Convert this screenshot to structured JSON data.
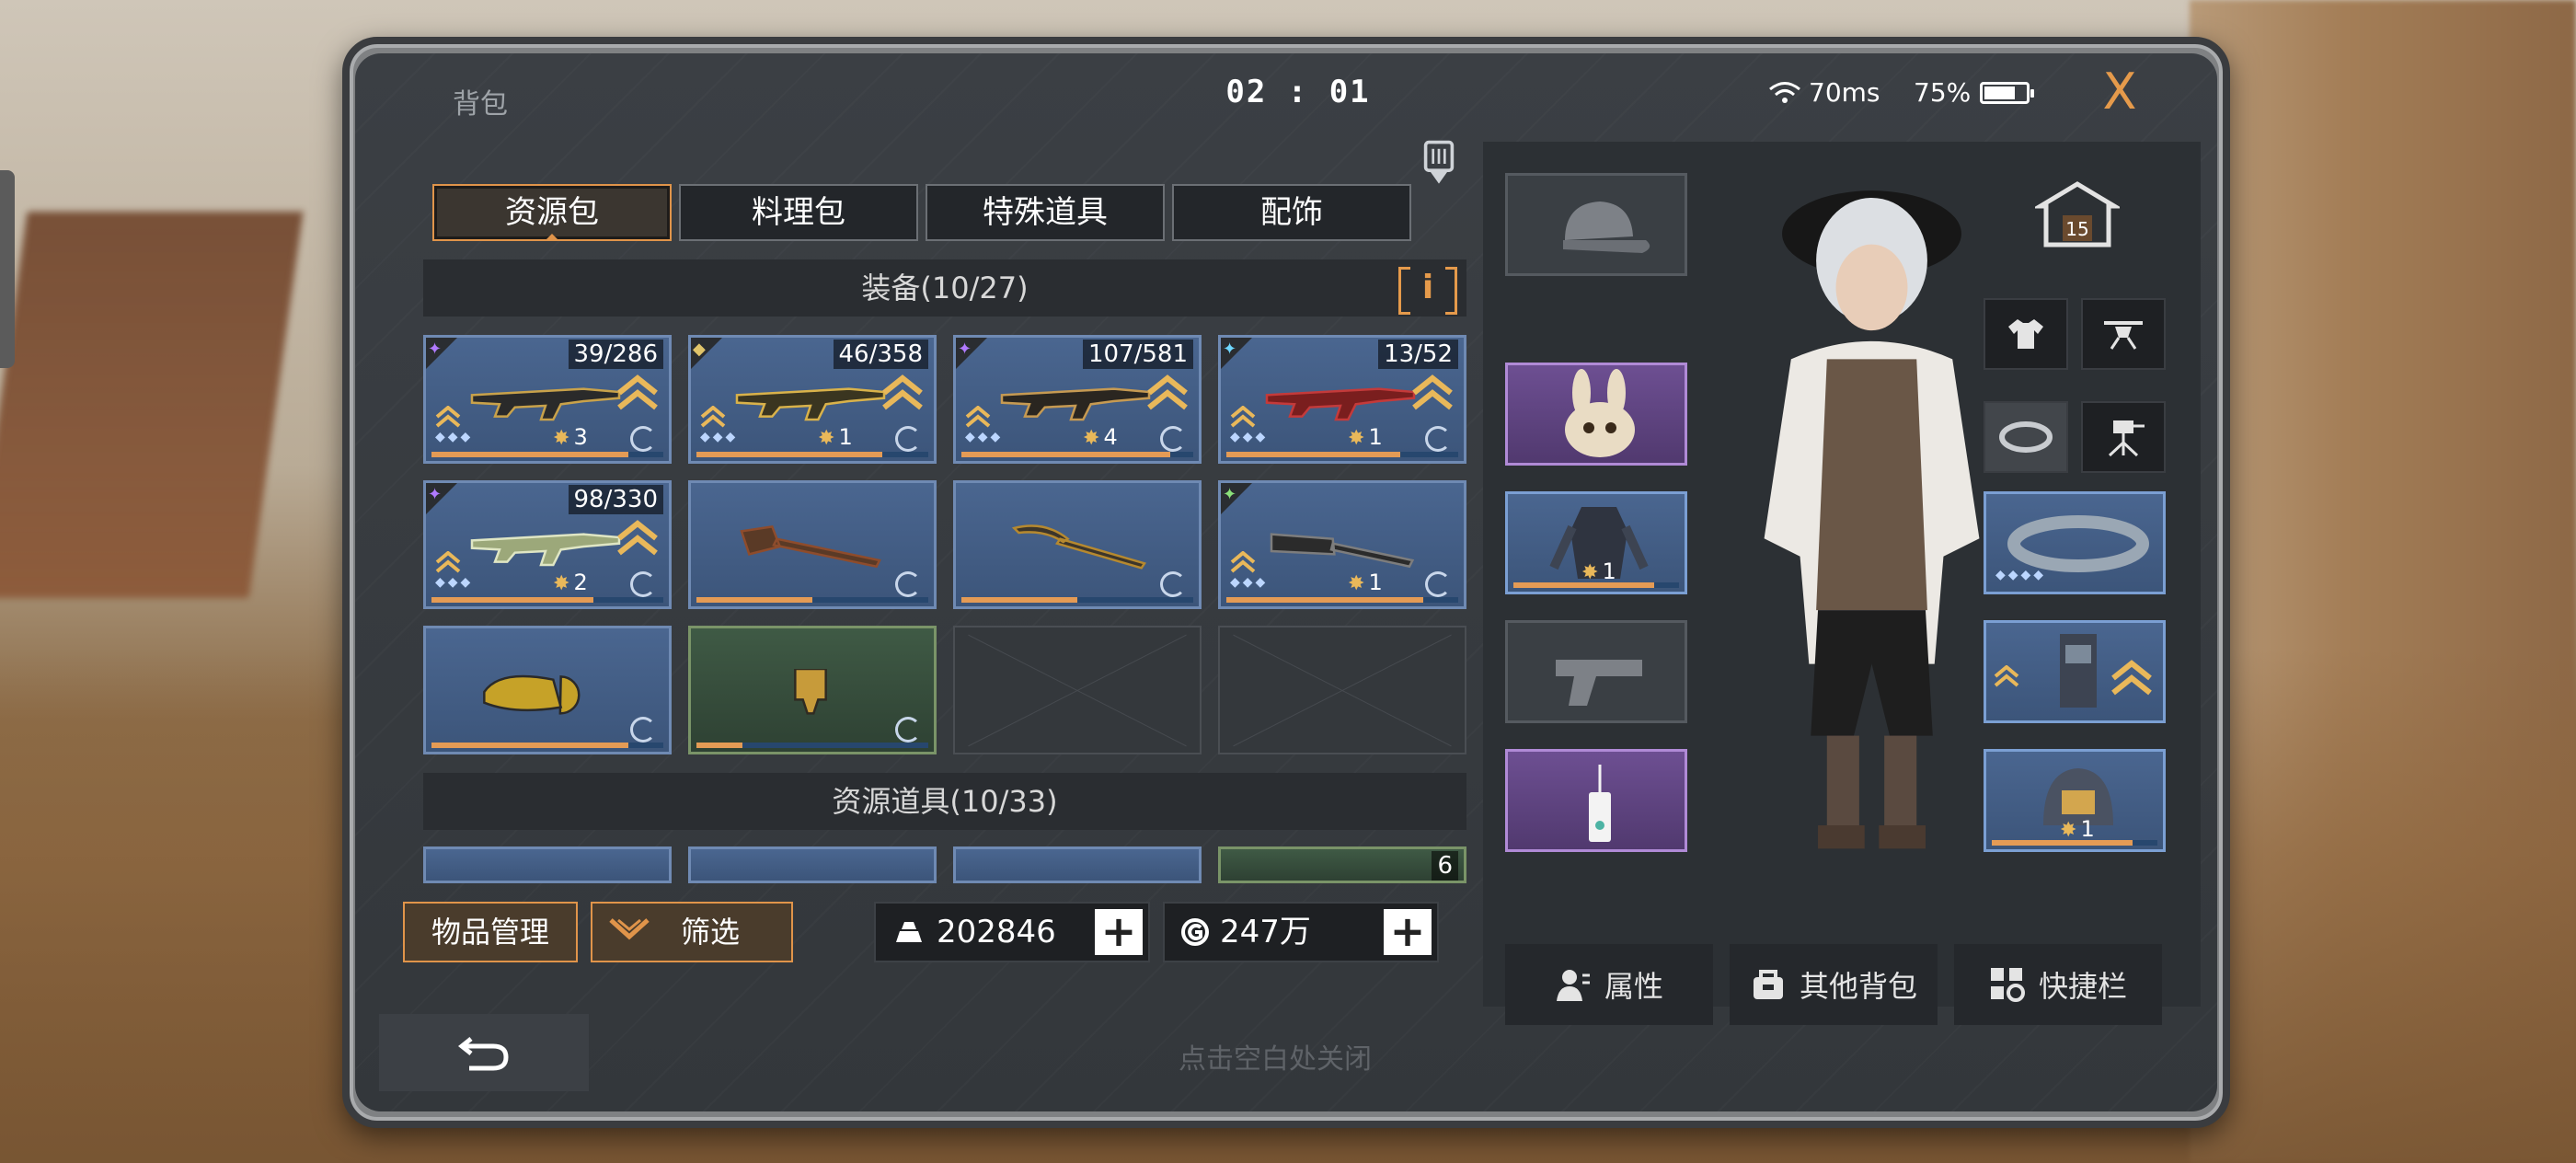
{
  "header": {
    "title": "背包",
    "clock": "02 : 01",
    "ping": "70ms",
    "battery": "75%",
    "battery_level": 0.75,
    "close_label": "X"
  },
  "tabs": [
    {
      "label": "资源包",
      "active": true
    },
    {
      "label": "料理包",
      "active": false
    },
    {
      "label": "特殊道具",
      "active": false
    },
    {
      "label": "配饰",
      "active": false
    }
  ],
  "sections": {
    "equipment": "装备(10/27)",
    "resources": "资源道具(10/33)",
    "info_label": "i"
  },
  "equipment_items": [
    {
      "name": "rifle-dark",
      "count": "39/286",
      "star": "3",
      "color": "#2a2a2a",
      "accent": "#c9a24a",
      "progress": 0.85,
      "tag": "violet"
    },
    {
      "name": "rifle-gold",
      "count": "46/358",
      "star": "1",
      "color": "#3a3520",
      "accent": "#d9b24a",
      "progress": 0.8,
      "tag": "gem"
    },
    {
      "name": "rifle-bronze",
      "count": "107/581",
      "star": "4",
      "color": "#2a2620",
      "accent": "#c69a52",
      "progress": 0.9,
      "tag": "violet"
    },
    {
      "name": "crossbow-red",
      "count": "13/52",
      "star": "1",
      "color": "#7a1e1e",
      "accent": "#c43a3a",
      "progress": 0.75,
      "tag": "cyan"
    },
    {
      "name": "smg-green",
      "count": "98/330",
      "star": "2",
      "color": "#9ca87a",
      "accent": "#dfe6c4",
      "progress": 0.7,
      "tag": "violet"
    },
    {
      "name": "axe-tool",
      "count": "",
      "star": "",
      "color": "#5a3a26",
      "accent": "#8e4c2c",
      "progress": 0.5,
      "tag": ""
    },
    {
      "name": "pickaxe-tool",
      "count": "",
      "star": "",
      "color": "#3c352a",
      "accent": "#b6892f",
      "progress": 0.5,
      "tag": ""
    },
    {
      "name": "club-spiked",
      "count": "",
      "star": "1",
      "color": "#2b2b2b",
      "accent": "#7d7d7d",
      "progress": 0.85,
      "tag": "green"
    },
    {
      "name": "chainsaw-gold",
      "count": "",
      "star": "",
      "color": "#c6a228",
      "accent": "#2a2a2a",
      "progress": 0.85,
      "tag": ""
    },
    {
      "name": "drill-tool",
      "count": "",
      "star": "",
      "color": "#c79b3a",
      "accent": "#2f2b22",
      "progress": 0.2,
      "tag": "",
      "green": true
    },
    {
      "empty": true
    },
    {
      "empty": true
    }
  ],
  "resource_items_visible_count": "6",
  "buttons": {
    "manage": "物品管理",
    "filter": "筛选"
  },
  "currency": {
    "gold": "202846",
    "coins": "247万"
  },
  "right_panel": {
    "level": "15",
    "slot_counts": [
      "1",
      "1"
    ],
    "bottom_buttons": [
      "属性",
      "其他背包",
      "快捷栏"
    ]
  },
  "footer": {
    "close_hint": "点击空白处关闭"
  },
  "colors": {
    "accent_orange": "#e0944a",
    "slot_blue": "#4a6690",
    "slot_purple": "#6d4f92"
  }
}
